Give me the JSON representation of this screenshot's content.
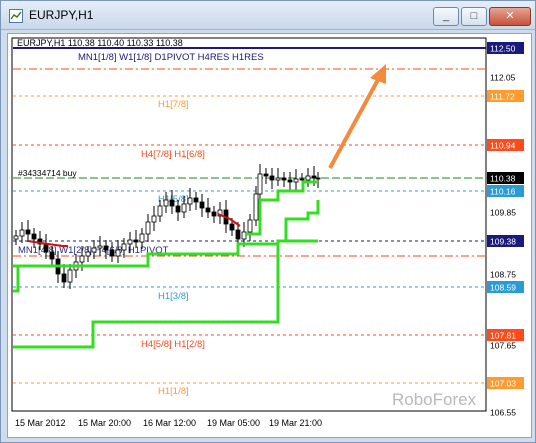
{
  "window": {
    "title": "EURJPY,H1",
    "buttons": {
      "minimize": "_",
      "maximize": "□",
      "close": "✕"
    }
  },
  "chart": {
    "info": "EURJPY,H1  110.38 110.40 110.33 110.38",
    "top_label": "MN1[1/8]  W1[1/8]  D1PIVOT  H4RES  H1RES",
    "order_label": "#34334714 buy",
    "levels": [
      {
        "label": "H1[7/8]",
        "color": "#ff9a2e"
      },
      {
        "label": "H4[7/8]  H1[6/8]",
        "color": "#ff4a1a"
      },
      {
        "label": "H1[5/8]",
        "color": "#2b9bd6"
      },
      {
        "label": "MN1[4/8]  W1[2/8]  H4[6/8]  H1PIVOT",
        "color": "#2b2b8a"
      },
      {
        "label": "H1[3/8]",
        "color": "#2b9bd6"
      },
      {
        "label": "H4[5/8]  H1[2/8]",
        "color": "#ff4a1a"
      },
      {
        "label": "H1[1/8]",
        "color": "#ff9a2e"
      }
    ],
    "price_axis": [
      "112.50",
      "112.05",
      "111.72",
      "110.94",
      "110.38",
      "110.16",
      "109.85",
      "109.38",
      "108.75",
      "108.59",
      "107.81",
      "107.65",
      "107.03",
      "106.55"
    ],
    "price_highlights": [
      {
        "value": "112.50",
        "bg": "#1a1a7a"
      },
      {
        "value": "111.72",
        "bg": "#ff9a2e"
      },
      {
        "value": "110.94",
        "bg": "#ff4a1a"
      },
      {
        "value": "110.38",
        "bg": "#000000"
      },
      {
        "value": "110.16",
        "bg": "#2b9bd6"
      },
      {
        "value": "109.38",
        "bg": "#1a1a7a"
      },
      {
        "value": "108.59",
        "bg": "#2b9bd6"
      },
      {
        "value": "107.81",
        "bg": "#ff4a1a"
      },
      {
        "value": "107.03",
        "bg": "#ff9a2e"
      }
    ],
    "time_axis": [
      "15 Mar 2012",
      "15 Mar 20:00",
      "16 Mar 12:00",
      "19 Mar 05:00",
      "19 Mar 21:00"
    ],
    "watermark": "RoboForex",
    "arrow_color": "#f58a3c",
    "trail_color": "#33dd22",
    "ma_red_color": "#cc1111"
  }
}
